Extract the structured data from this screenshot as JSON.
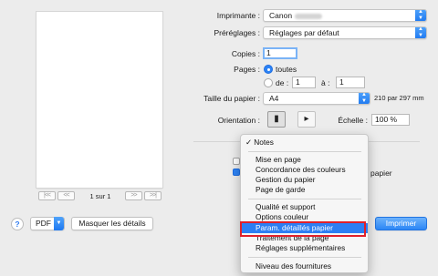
{
  "preview": {
    "page_count": "1 sur 1",
    "first_label": "|<<",
    "prev_label": "<<",
    "next_label": ">>",
    "last_label": ">>|"
  },
  "form": {
    "printer_label": "Imprimante :",
    "printer_value": "Canon",
    "presets_label": "Préréglages :",
    "presets_value": "Réglages par défaut",
    "copies_label": "Copies :",
    "copies_value": "1",
    "pages_label": "Pages :",
    "pages_all": "toutes",
    "pages_from": "de :",
    "pages_from_value": "1",
    "pages_to": "à :",
    "pages_to_value": "1",
    "paper_size_label": "Taille du papier :",
    "paper_size_value": "A4",
    "paper_size_dims": "210 par 297 mm",
    "orientation_label": "Orientation :",
    "scale_label": "Échelle :",
    "scale_value": "100 %",
    "checkbox_paper_fragment": "papier"
  },
  "bottom": {
    "help": "?",
    "pdf": "PDF",
    "hide_details": "Masquer les détails",
    "print": "Imprimer"
  },
  "menu": {
    "checked_item": "Notes",
    "check_mark": "✓",
    "items": [
      "Mise en page",
      "Concordance des couleurs",
      "Gestion du papier",
      "Page de garde",
      "Qualité et support",
      "Options couleur",
      "Param. détaillés papier",
      "Traitement de la page",
      "Réglages supplémentaires",
      "Niveau des fournitures"
    ],
    "highlighted_index": 6
  },
  "colors": {
    "accent": "#2d7ef3",
    "callout": "#e0202a"
  }
}
